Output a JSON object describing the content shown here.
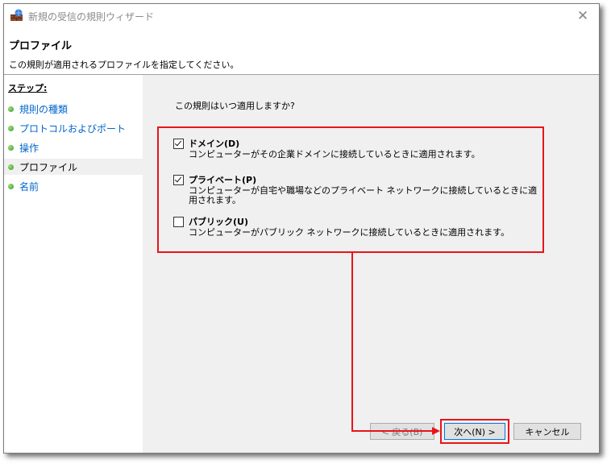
{
  "window": {
    "title": "新規の受信の規則ウィザード"
  },
  "header": {
    "title": "プロファイル",
    "description": "この規則が適用されるプロファイルを指定してください。"
  },
  "sidebar": {
    "steps_label": "ステップ:",
    "items": [
      {
        "label": "規則の種類",
        "state": "link"
      },
      {
        "label": "プロトコルおよびポート",
        "state": "link"
      },
      {
        "label": "操作",
        "state": "link"
      },
      {
        "label": "プロファイル",
        "state": "current"
      },
      {
        "label": "名前",
        "state": "link"
      }
    ]
  },
  "main": {
    "question": "この規則はいつ適用しますか?",
    "options": [
      {
        "label": "ドメイン(D)",
        "checked": true,
        "description": "コンピューターがその企業ドメインに接続しているときに適用されます。"
      },
      {
        "label": "プライベート(P)",
        "checked": true,
        "description": "コンピューターが自宅や職場などのプライベート ネットワークに接続しているときに適用されます。"
      },
      {
        "label": "パブリック(U)",
        "checked": false,
        "description": "コンピューターがパブリック ネットワークに接続しているときに適用されます。"
      }
    ]
  },
  "buttons": {
    "back": "< 戻る(B)",
    "next": "次へ(N) >",
    "cancel": "キャンセル"
  },
  "colors": {
    "annotation": "#e8141c",
    "link": "#0066cc"
  },
  "icons": {
    "app": "firewall-icon",
    "close": "close-icon",
    "step": "green-dot-icon",
    "checked": "checkbox-checked-icon",
    "unchecked": "checkbox-unchecked-icon"
  }
}
